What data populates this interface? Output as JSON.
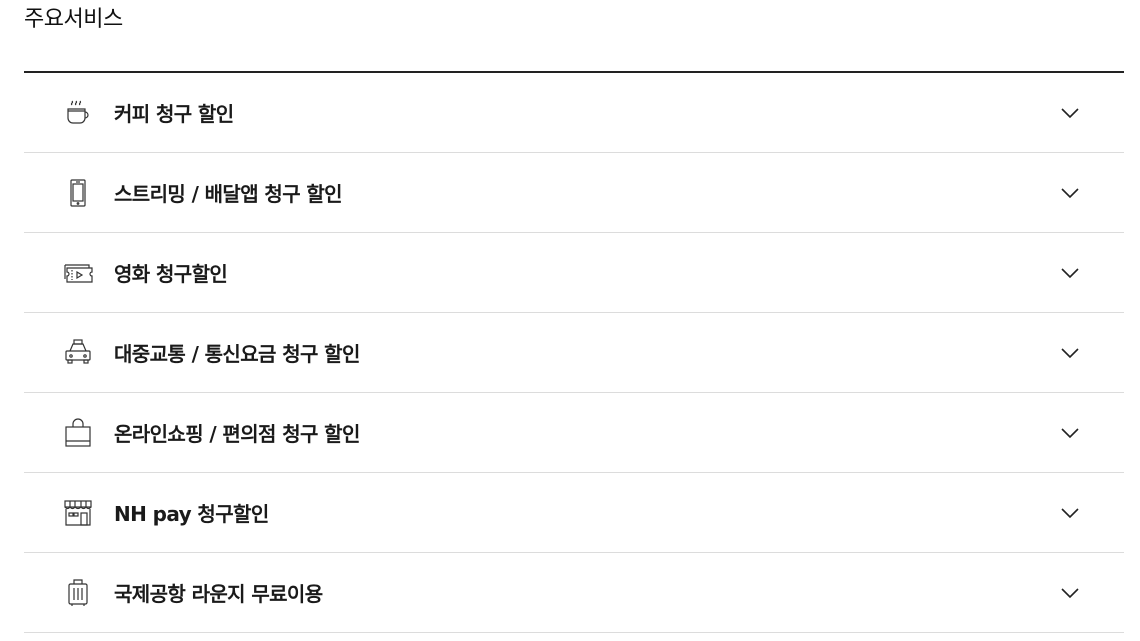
{
  "section": {
    "title": "주요서비스"
  },
  "items": [
    {
      "icon": "coffee-cup-icon",
      "label": "커피 청구 할인"
    },
    {
      "icon": "smartphone-icon",
      "label": "스트리밍 / 배달앱 청구 할인"
    },
    {
      "icon": "movie-ticket-icon",
      "label": "영화 청구할인"
    },
    {
      "icon": "taxi-icon",
      "label": "대중교통 / 통신요금 청구 할인"
    },
    {
      "icon": "shopping-bag-icon",
      "label": "온라인쇼핑 / 편의점 청구 할인"
    },
    {
      "icon": "store-icon",
      "label": "NH pay 청구할인"
    },
    {
      "icon": "luggage-icon",
      "label": "국제공항 라운지 무료이용"
    }
  ],
  "colors": {
    "text": "#1a1a1a",
    "rule": "#222222",
    "divider": "#dcdcdc",
    "icon": "#333333"
  }
}
